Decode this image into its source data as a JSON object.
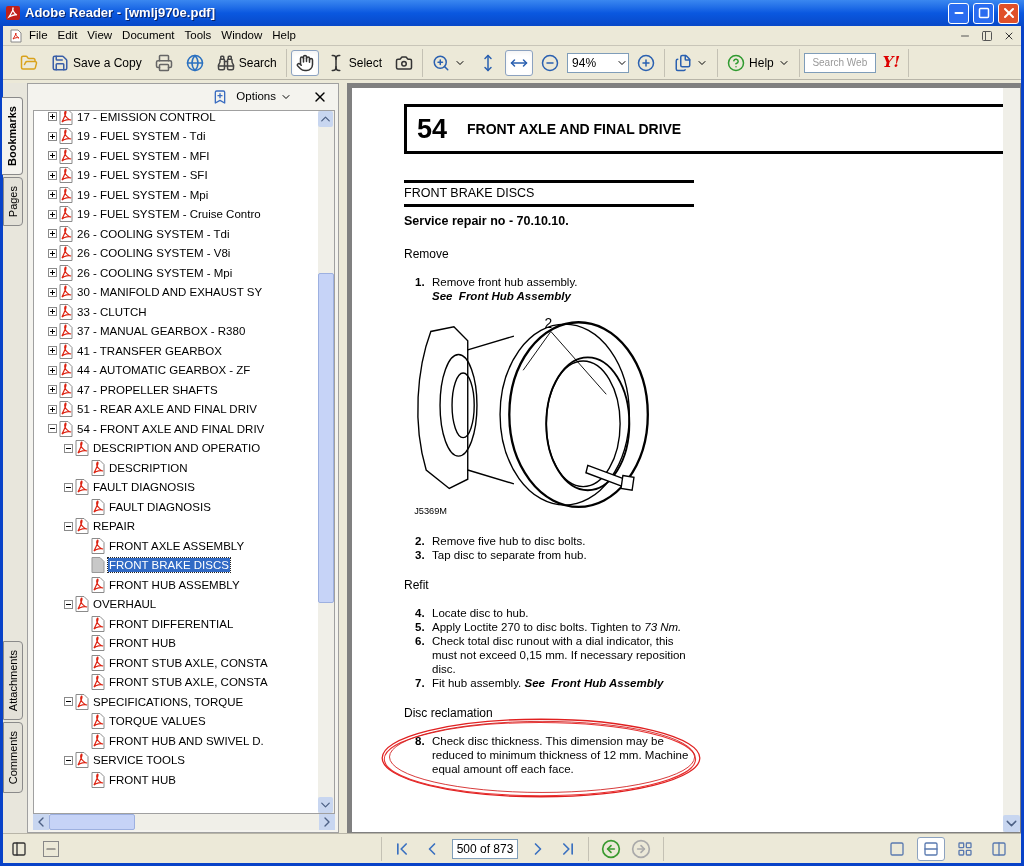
{
  "window": {
    "title": "Adobe Reader - [wmlj970e.pdf]"
  },
  "menu": [
    "File",
    "Edit",
    "View",
    "Document",
    "Tools",
    "Window",
    "Help"
  ],
  "toolbar": {
    "groups": [
      [
        {
          "kind": "open",
          "pressed": false
        },
        {
          "kind": "save",
          "label": "Save a Copy",
          "pressed": false
        },
        {
          "kind": "print",
          "pressed": false
        },
        {
          "kind": "globe",
          "pressed": false
        },
        {
          "kind": "search",
          "label": "Search",
          "pressed": false
        }
      ],
      [
        {
          "kind": "hand",
          "pressed": true
        },
        {
          "kind": "select",
          "label": "Select",
          "pressed": false
        },
        {
          "kind": "snapshot",
          "pressed": false
        }
      ],
      [
        {
          "kind": "zoom-menu",
          "pressed": false
        },
        {
          "kind": "fit-page",
          "pressed": false
        },
        {
          "kind": "fit-width",
          "pressed": true
        },
        {
          "kind": "zoom-out",
          "pressed": false
        },
        {
          "kind": "zoom-field",
          "value": "94%"
        },
        {
          "kind": "zoom-in",
          "pressed": false
        }
      ],
      [
        {
          "kind": "pages-menu",
          "pressed": false
        }
      ],
      [
        {
          "kind": "help",
          "label": "Help",
          "pressed": false
        }
      ],
      [
        {
          "kind": "search-field",
          "placeholder": "Search Web"
        },
        {
          "kind": "logo",
          "text": "Y!"
        }
      ]
    ]
  },
  "side_tabs": {
    "top": [
      {
        "label": "Bookmarks",
        "selected": true
      },
      {
        "label": "Pages",
        "selected": false
      }
    ],
    "bottom": [
      {
        "label": "Attachments",
        "selected": false
      },
      {
        "label": "Comments",
        "selected": false
      }
    ]
  },
  "bookmarks": {
    "options": "Options",
    "items": [
      {
        "label": "17 - EMISSION CONTROL",
        "expanded": false,
        "selected": false
      },
      {
        "label": "19 - FUEL SYSTEM - Tdi",
        "expanded": false,
        "selected": false
      },
      {
        "label": "19 - FUEL SYSTEM - MFI",
        "expanded": false,
        "selected": false
      },
      {
        "label": "19 - FUEL SYSTEM - SFI",
        "expanded": false,
        "selected": false
      },
      {
        "label": "19 - FUEL SYSTEM - Mpi",
        "expanded": false,
        "selected": false
      },
      {
        "label": "19 - FUEL SYSTEM - Cruise Contro",
        "expanded": false,
        "selected": false
      },
      {
        "label": "26 - COOLING SYSTEM - Tdi",
        "expanded": false,
        "selected": false
      },
      {
        "label": "26 - COOLING SYSTEM - V8i",
        "expanded": false,
        "selected": false
      },
      {
        "label": "26 - COOLING SYSTEM - Mpi",
        "expanded": false,
        "selected": false
      },
      {
        "label": "30 - MANIFOLD AND EXHAUST SY",
        "expanded": false,
        "selected": false
      },
      {
        "label": "33 - CLUTCH",
        "expanded": false,
        "selected": false
      },
      {
        "label": "37 - MANUAL GEARBOX - R380",
        "expanded": false,
        "selected": false
      },
      {
        "label": "41 - TRANSFER GEARBOX",
        "expanded": false,
        "selected": false
      },
      {
        "label": "44 - AUTOMATIC GEARBOX - ZF",
        "expanded": false,
        "selected": false
      },
      {
        "label": "47 - PROPELLER SHAFTS",
        "expanded": false,
        "selected": false
      },
      {
        "label": "51 - REAR AXLE AND FINAL DRIV",
        "expanded": false,
        "selected": false
      },
      {
        "label": "54 - FRONT AXLE AND FINAL DRIV",
        "expanded": true,
        "selected": false,
        "children": [
          {
            "label": "DESCRIPTION AND OPERATIO",
            "expanded": true,
            "selected": false,
            "children": [
              {
                "label": "DESCRIPTION",
                "selected": false
              }
            ]
          },
          {
            "label": "FAULT DIAGNOSIS",
            "expanded": true,
            "selected": false,
            "children": [
              {
                "label": "FAULT DIAGNOSIS",
                "selected": false
              }
            ]
          },
          {
            "label": "REPAIR",
            "expanded": true,
            "selected": false,
            "children": [
              {
                "label": "FRONT AXLE ASSEMBLY",
                "selected": false
              },
              {
                "label": "FRONT BRAKE DISCS",
                "selected": true
              },
              {
                "label": "FRONT HUB ASSEMBLY",
                "selected": false
              }
            ]
          },
          {
            "label": "OVERHAUL",
            "expanded": true,
            "selected": false,
            "children": [
              {
                "label": "FRONT DIFFERENTIAL",
                "selected": false
              },
              {
                "label": "FRONT HUB",
                "selected": false
              },
              {
                "label": "FRONT STUB AXLE, CONSTA",
                "selected": false
              },
              {
                "label": "FRONT STUB AXLE, CONSTA",
                "selected": false
              }
            ]
          },
          {
            "label": "SPECIFICATIONS, TORQUE",
            "expanded": true,
            "selected": false,
            "children": [
              {
                "label": "TORQUE VALUES",
                "selected": false
              },
              {
                "label": "FRONT HUB AND SWIVEL D.",
                "selected": false
              }
            ]
          },
          {
            "label": "SERVICE TOOLS",
            "expanded": true,
            "selected": false,
            "children": [
              {
                "label": "FRONT HUB",
                "selected": false
              }
            ]
          }
        ]
      }
    ]
  },
  "document": {
    "chapter_number": "54",
    "chapter_title": "FRONT AXLE AND FINAL DRIVE",
    "section_title": "FRONT BRAKE DISCS",
    "service_repair": "Service repair no - 70.10.10.",
    "blocks": [
      {
        "kind": "heading",
        "text": "Remove"
      },
      {
        "kind": "step",
        "number": "1.",
        "text": "Remove front hub assembly.",
        "ref": "See  Front Hub Assembly"
      },
      {
        "kind": "figure",
        "callout": "2",
        "code": "J5369M"
      },
      {
        "kind": "step",
        "number": "2.",
        "text": "Remove five hub to disc bolts."
      },
      {
        "kind": "step",
        "number": "3.",
        "text": "Tap disc to separate from hub."
      },
      {
        "kind": "heading",
        "text": "Refit"
      },
      {
        "kind": "step",
        "number": "4.",
        "text": "Locate disc to hub."
      },
      {
        "kind": "step",
        "number": "5.",
        "text": "Apply Loctite 270 to disc bolts.  Tighten to *73 Nm.*"
      },
      {
        "kind": "step",
        "number": "6.",
        "text": "Check total disc runout with a dial indicator, this must not exceed 0,15 mm. If necessary reposition disc."
      },
      {
        "kind": "step",
        "number": "7.",
        "text": "Fit hub assembly.",
        "ref": "See  Front Hub Assembly"
      },
      {
        "kind": "heading",
        "text": "Disc reclamation"
      },
      {
        "kind": "step",
        "number": "8.",
        "text": "Check disc thickness. This dimension may be reduced to minimum thickness of 12 mm. Machine equal amount off each face.",
        "circled": true
      }
    ]
  },
  "status_bar": {
    "page_field": "500 of 873",
    "history": [
      {
        "kind": "back",
        "disabled": false
      },
      {
        "kind": "forward",
        "disabled": true
      }
    ],
    "view_modes": [
      {
        "kind": "single",
        "selected": false
      },
      {
        "kind": "continuous",
        "selected": true
      },
      {
        "kind": "continuous-facing",
        "selected": false
      },
      {
        "kind": "facing",
        "selected": false
      }
    ]
  }
}
